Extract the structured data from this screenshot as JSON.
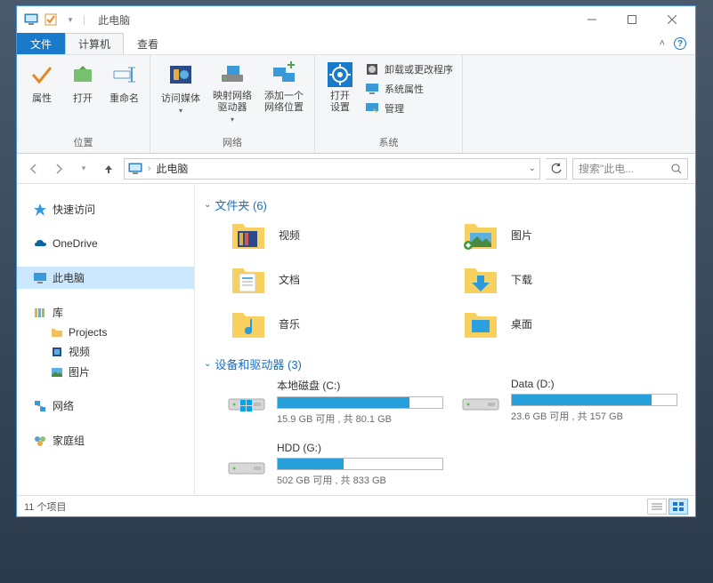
{
  "window": {
    "title": "此电脑"
  },
  "ribbon": {
    "tabs": {
      "file": "文件",
      "computer": "计算机",
      "view": "查看"
    },
    "groups": {
      "location": {
        "label": "位置",
        "properties": "属性",
        "open": "打开",
        "rename": "重命名"
      },
      "network": {
        "label": "网络",
        "media": "访问媒体",
        "mapdrive": "映射网络\n驱动器",
        "addloc": "添加一个\n网络位置"
      },
      "system": {
        "label": "系统",
        "settings": "打开\n设置",
        "uninstall": "卸载或更改程序",
        "sysprops": "系统属性",
        "manage": "管理"
      }
    }
  },
  "nav": {
    "breadcrumb": "此电脑",
    "search_placeholder": "搜索\"此电... "
  },
  "tree": {
    "quick": "快速访问",
    "onedrive": "OneDrive",
    "thispc": "此电脑",
    "libraries": "库",
    "lib_projects": "Projects",
    "lib_videos": "视频",
    "lib_pictures": "图片",
    "network": "网络",
    "homegroup": "家庭组"
  },
  "sections": {
    "folders": {
      "title": "文件夹 (6)",
      "items": {
        "videos": "视频",
        "pictures": "图片",
        "documents": "文档",
        "downloads": "下载",
        "music": "音乐",
        "desktop": "桌面"
      }
    },
    "drives": {
      "title": "设备和驱动器 (3)",
      "items": [
        {
          "name": "本地磁盘 (C:)",
          "free": "15.9 GB 可用 , 共 80.1 GB",
          "pct": 80,
          "os": true
        },
        {
          "name": "Data (D:)",
          "free": "23.6 GB 可用 , 共 157 GB",
          "pct": 85,
          "os": false
        },
        {
          "name": "HDD (G:)",
          "free": "502 GB 可用 , 共 833 GB",
          "pct": 40,
          "os": false
        }
      ]
    }
  },
  "status": {
    "items": "11 个项目"
  }
}
